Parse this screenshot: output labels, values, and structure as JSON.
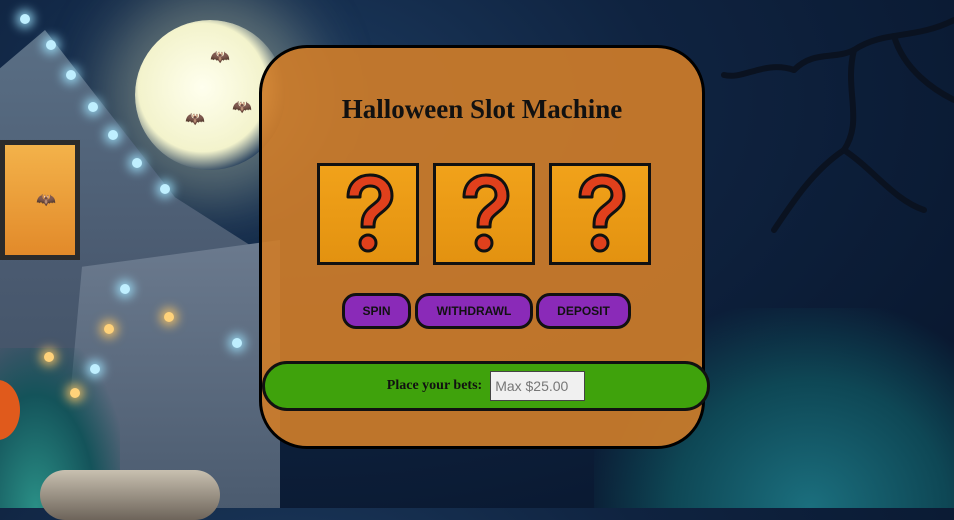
{
  "game": {
    "title": "Halloween Slot Machine",
    "reels": [
      {
        "symbol": "?",
        "icon": "question-mark-icon"
      },
      {
        "symbol": "?",
        "icon": "question-mark-icon"
      },
      {
        "symbol": "?",
        "icon": "question-mark-icon"
      }
    ],
    "buttons": {
      "spin": "SPIN",
      "withdraw": "WITHDRAWL",
      "deposit": "DEPOSIT"
    },
    "bets": {
      "label": "Place your bets:",
      "placeholder": "Max $25.00",
      "value": ""
    }
  },
  "colors": {
    "panel": "#cc7c2a",
    "reel": "#f1a21a",
    "button": "#8a2ab8",
    "bets_bar": "#3fa20c",
    "question_mark": "#e0401c"
  }
}
